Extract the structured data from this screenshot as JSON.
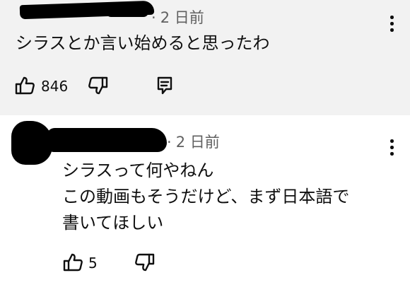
{
  "theme": {
    "highlight_bg": "#f2f2f2",
    "text_color": "#0f0f0f",
    "meta_color": "#606060"
  },
  "comments": [
    {
      "separator": "·",
      "time": "2 日前",
      "lines": [
        "シラスとか言い始めると思ったわ"
      ],
      "like_count": "846",
      "highlighted": true,
      "icons": [
        "thumb-up-icon",
        "thumb-down-icon",
        "reply-icon",
        "more-vert-icon"
      ]
    },
    {
      "separator": "·",
      "time": "2 日前",
      "lines": [
        "シラスって何やねん",
        "この動画もそうだけど、まず日本語で",
        "書いてほしい"
      ],
      "like_count": "5",
      "highlighted": false,
      "icons": [
        "thumb-up-icon",
        "thumb-down-icon",
        "more-vert-icon"
      ]
    }
  ]
}
